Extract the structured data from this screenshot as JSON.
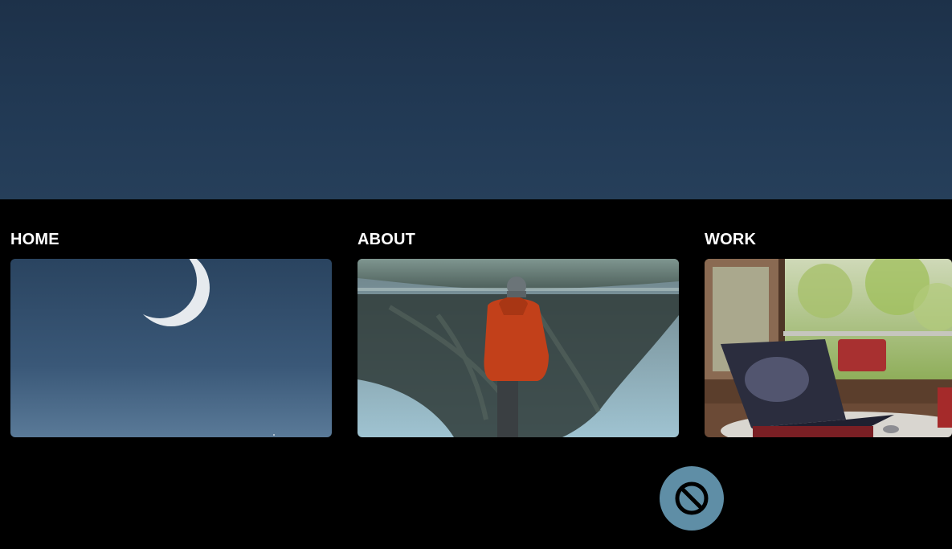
{
  "menu": {
    "items": [
      {
        "label": "HOME",
        "image": "crescent-moon-night-sky"
      },
      {
        "label": "ABOUT",
        "image": "person-at-mountain-lake"
      },
      {
        "label": "WORK",
        "image": "laptop-on-desk-by-window"
      }
    ]
  },
  "colors": {
    "hero_background": "#223a55",
    "menu_background": "#000000",
    "label_text": "#ffffff",
    "cursor_button": "#5f8ea6"
  },
  "icons": {
    "cursor": "not-allowed-icon"
  }
}
